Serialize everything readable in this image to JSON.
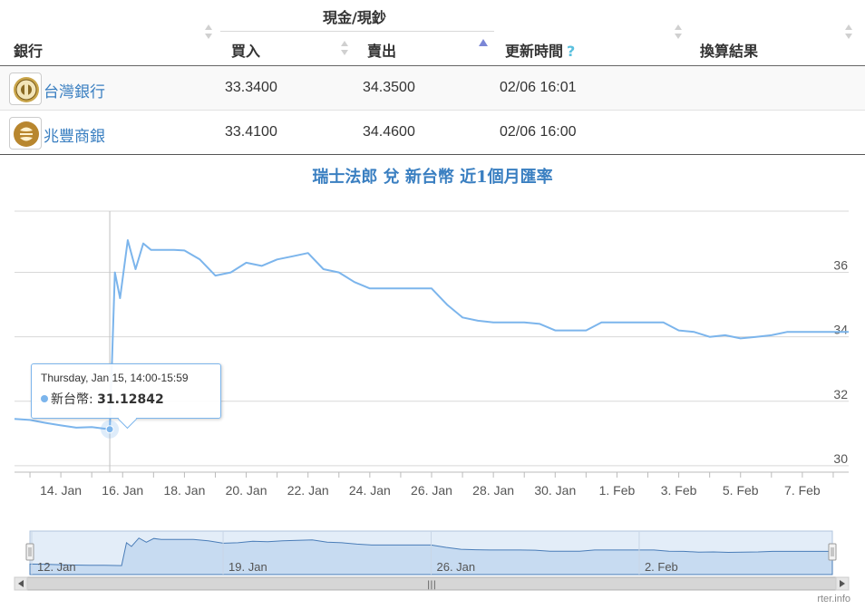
{
  "table": {
    "group_header": "現金/現鈔",
    "headers": {
      "bank": "銀行",
      "buy": "買入",
      "sell": "賣出",
      "updated": "更新時間",
      "help": "?",
      "result": "換算結果"
    },
    "rows": [
      {
        "bank": "台灣銀行",
        "buy": "33.3400",
        "sell": "34.3500",
        "updated": "02/06 16:01",
        "logo_icon": "bank-of-taiwan-logo-icon"
      },
      {
        "bank": "兆豐商銀",
        "buy": "33.4100",
        "sell": "34.4600",
        "updated": "02/06 16:00",
        "logo_icon": "mega-bank-logo-icon"
      }
    ]
  },
  "chart_data": {
    "type": "line",
    "title": "瑞士法郎 兌 新台幣 近1個月匯率",
    "xlabel": "",
    "ylabel": "",
    "x_ticks": [
      "14. Jan",
      "16. Jan",
      "18. Jan",
      "20. Jan",
      "22. Jan",
      "24. Jan",
      "26. Jan",
      "28. Jan",
      "30. Jan",
      "1. Feb",
      "3. Feb",
      "5. Feb",
      "7. Feb"
    ],
    "y_ticks": [
      "30",
      "32",
      "34",
      "36"
    ],
    "ylim": [
      29.8,
      37.9
    ],
    "xlim": [
      "2015-01-12T12:00",
      "2015-02-08T12:00"
    ],
    "grid": true,
    "line_color": "#7cb5ec",
    "series": [
      {
        "name": "新台幣",
        "x": [
          "2015-01-12T12:00",
          "2015-01-13T00:00",
          "2015-01-13T12:00",
          "2015-01-14T00:00",
          "2015-01-14T12:00",
          "2015-01-15T00:00",
          "2015-01-15T14:00",
          "2015-01-15T18:00",
          "2015-01-15T22:00",
          "2015-01-16T04:00",
          "2015-01-16T10:00",
          "2015-01-16T16:00",
          "2015-01-16T22:00",
          "2015-01-17T04:00",
          "2015-01-17T10:00",
          "2015-01-17T16:00",
          "2015-01-18T00:00",
          "2015-01-18T12:00",
          "2015-01-19T00:00",
          "2015-01-19T12:00",
          "2015-01-20T00:00",
          "2015-01-20T12:00",
          "2015-01-21T00:00",
          "2015-01-21T12:00",
          "2015-01-22T00:00",
          "2015-01-22T12:00",
          "2015-01-23T00:00",
          "2015-01-23T12:00",
          "2015-01-24T00:00",
          "2015-01-24T12:00",
          "2015-01-25T00:00",
          "2015-01-25T12:00",
          "2015-01-26T00:00",
          "2015-01-26T12:00",
          "2015-01-27T00:00",
          "2015-01-27T12:00",
          "2015-01-28T00:00",
          "2015-01-28T12:00",
          "2015-01-29T00:00",
          "2015-01-29T12:00",
          "2015-01-30T00:00",
          "2015-01-30T12:00",
          "2015-01-31T00:00",
          "2015-01-31T12:00",
          "2015-02-01T00:00",
          "2015-02-01T12:00",
          "2015-02-02T00:00",
          "2015-02-02T12:00",
          "2015-02-03T00:00",
          "2015-02-03T12:00",
          "2015-02-04T00:00",
          "2015-02-04T12:00",
          "2015-02-05T00:00",
          "2015-02-05T12:00",
          "2015-02-06T00:00",
          "2015-02-06T12:00",
          "2015-02-07T00:00",
          "2015-02-07T12:00",
          "2015-02-08T00:00",
          "2015-02-08T12:00"
        ],
        "y": [
          31.45,
          31.42,
          31.33,
          31.25,
          31.18,
          31.2,
          31.13,
          36.0,
          35.2,
          37.0,
          36.1,
          36.9,
          36.7,
          36.7,
          36.7,
          36.7,
          36.68,
          36.4,
          35.9,
          36.0,
          36.3,
          36.2,
          36.4,
          36.5,
          36.6,
          36.1,
          36.0,
          35.7,
          35.5,
          35.5,
          35.5,
          35.5,
          35.5,
          35.0,
          34.6,
          34.5,
          34.45,
          34.45,
          34.45,
          34.4,
          34.2,
          34.2,
          34.2,
          34.45,
          34.45,
          34.45,
          34.45,
          34.45,
          34.2,
          34.15,
          34.0,
          34.05,
          33.95,
          34.0,
          34.05,
          34.15,
          34.15,
          34.15,
          34.15,
          34.15
        ]
      }
    ],
    "tooltip": {
      "date": "Thursday, Jan 15, 14:00-15:59",
      "series_name": "新台幣",
      "value": "31.12842"
    },
    "navigator": {
      "x_ticks": [
        "12. Jan",
        "19. Jan",
        "26. Jan",
        "2. Feb"
      ],
      "scrollbar_handle": "|||"
    },
    "credit": "rter.info"
  }
}
